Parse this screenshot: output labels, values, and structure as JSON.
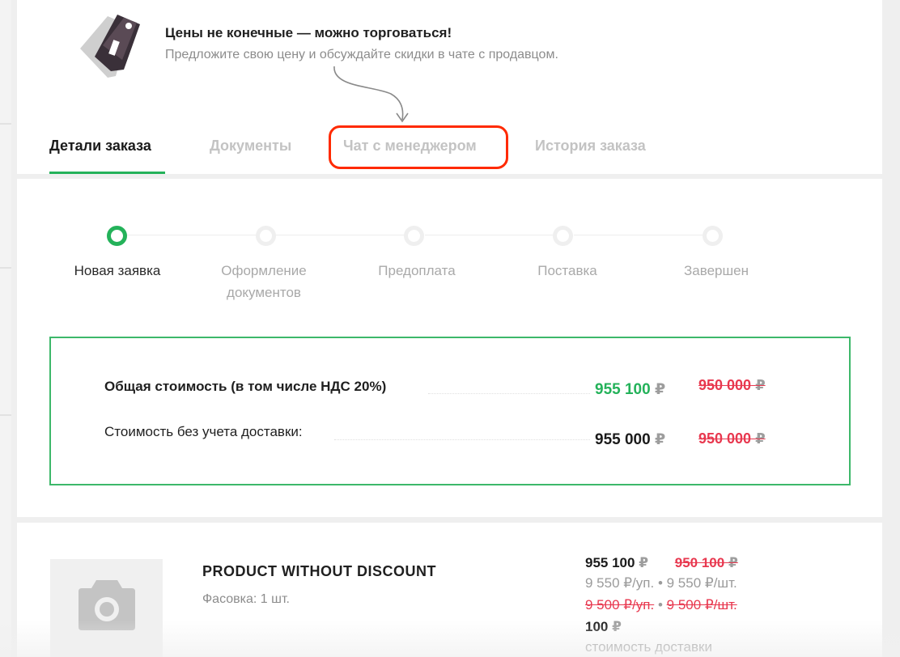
{
  "banner": {
    "title": "Цены не конечные — можно торговаться!",
    "subtitle": "Предложите свою цену и обсуждайте скидки в чате с продавцом."
  },
  "tabs": [
    {
      "label": "Детали заказа",
      "active": true
    },
    {
      "label": "Документы",
      "active": false
    },
    {
      "label": "Чат с менеджером",
      "active": false
    },
    {
      "label": "История заказа",
      "active": false
    }
  ],
  "steps": [
    {
      "label": "Новая заявка",
      "active": true
    },
    {
      "label": "Оформление документов",
      "active": false
    },
    {
      "label": "Предоплата",
      "active": false
    },
    {
      "label": "Поставка",
      "active": false
    },
    {
      "label": "Завершен",
      "active": false
    }
  ],
  "summary": {
    "total_label": "Общая стоимость (в том числе НДС 20%)",
    "total_price": "955 100",
    "total_old": "950 000",
    "no_delivery_label": "Стоимость без учета доставки:",
    "no_delivery_price": "955 000",
    "no_delivery_old": "950 000",
    "currency": "₽"
  },
  "product": {
    "name": "PRODUCT WITHOUT DISCOUNT",
    "packing": "Фасовка: 1 шт.",
    "price": "955 100",
    "price_old": "950 100",
    "unit_prices": "9 550 ₽/уп. • 9 550 ₽/шт.",
    "unit_prices_old_1": "9 500 ₽/уп.",
    "unit_prices_sep": " • ",
    "unit_prices_old_2": "9 500 ₽/шт.",
    "delivery_price": "100",
    "delivery_label": "стоимость доставки"
  },
  "colors": {
    "accent": "#24b25a",
    "highlight": "#ff2a00",
    "discount": "#e8384f"
  }
}
